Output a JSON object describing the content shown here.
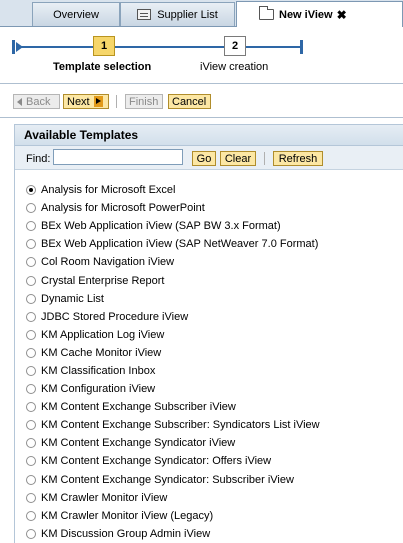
{
  "tabs": [
    {
      "label": "Overview",
      "icon": null
    },
    {
      "label": "Supplier List",
      "icon": "document-list-icon"
    },
    {
      "label": "New iView",
      "icon": "folder-icon",
      "active": true,
      "close": "✖"
    }
  ],
  "roadmap": {
    "steps": [
      {
        "number": "1",
        "label": "Template selection",
        "active": true
      },
      {
        "number": "2",
        "label": "iView creation",
        "active": false
      }
    ]
  },
  "toolbar": {
    "back_label": "Back",
    "next_label": "Next",
    "finish_label": "Finish",
    "cancel_label": "Cancel"
  },
  "panel": {
    "title": "Available Templates",
    "find_label": "Find:",
    "find_value": "",
    "go_label": "Go",
    "clear_label": "Clear",
    "refresh_label": "Refresh"
  },
  "templates": [
    {
      "label": "Analysis for Microsoft Excel",
      "selected": true
    },
    {
      "label": "Analysis for Microsoft PowerPoint",
      "selected": false
    },
    {
      "label": "BEx Web Application iView (SAP BW 3.x Format)",
      "selected": false
    },
    {
      "label": "BEx Web Application iView (SAP NetWeaver 7.0 Format)",
      "selected": false
    },
    {
      "label": "Col Room Navigation iView",
      "selected": false
    },
    {
      "label": "Crystal Enterprise Report",
      "selected": false
    },
    {
      "label": "Dynamic List",
      "selected": false
    },
    {
      "label": "JDBC Stored Procedure iView",
      "selected": false
    },
    {
      "label": "KM Application Log iView",
      "selected": false
    },
    {
      "label": "KM Cache Monitor iView",
      "selected": false
    },
    {
      "label": "KM Classification Inbox",
      "selected": false
    },
    {
      "label": "KM Configuration iView",
      "selected": false
    },
    {
      "label": "KM Content Exchange Subscriber iView",
      "selected": false
    },
    {
      "label": "KM Content Exchange Subscriber: Syndicators List iView",
      "selected": false
    },
    {
      "label": "KM Content Exchange Syndicator iView",
      "selected": false
    },
    {
      "label": "KM Content Exchange Syndicator: Offers iView",
      "selected": false
    },
    {
      "label": "KM Content Exchange Syndicator: Subscriber iView",
      "selected": false
    },
    {
      "label": "KM Crawler Monitor iView",
      "selected": false
    },
    {
      "label": "KM Crawler Monitor iView (Legacy)",
      "selected": false
    },
    {
      "label": "KM Discussion Group Admin iView",
      "selected": false
    }
  ],
  "colors": {
    "accent_blue": "#2e67a6",
    "button_yellow": "#fce7a4",
    "active_step": "#f6d66a"
  }
}
